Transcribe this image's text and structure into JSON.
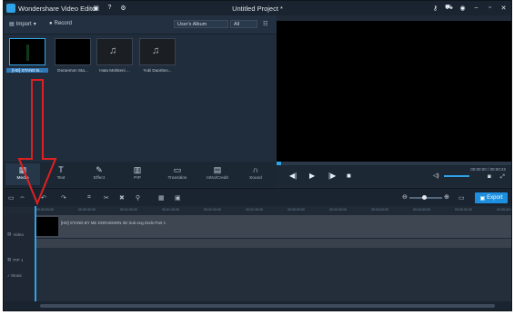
{
  "app": {
    "title": "Wondershare Video Editor",
    "project_title": "Untitled Project *"
  },
  "library_toolbar": {
    "import_label": "Import",
    "record_label": "Record",
    "album_value": "User's Album",
    "filter_value": "All"
  },
  "media": [
    {
      "label": "[HD] STAND B..."
    },
    {
      "label": "Doraemon Sta..."
    },
    {
      "label": "Hata Mohiteni ..."
    },
    {
      "label": "Yuki Daoriteo..."
    }
  ],
  "tabs": [
    "Media",
    "Text",
    "Effect",
    "PIP",
    "Transition",
    "Intro/Credit",
    "Sound"
  ],
  "preview": {
    "timecode": "00:00:00 / 00:00:22",
    "progress": 0.02
  },
  "timeline": {
    "export_label": "Export",
    "ruler": [
      "00:00:00:00",
      "00:00:30:00",
      "00:01:00:00",
      "00:01:30:00",
      "00:02:00:00",
      "00:02:30:00",
      "00:03:00:00",
      "00:03:30:00",
      "00:04:00:00",
      "00:04:30:00",
      "00:05:00:00",
      "00:05:30:00"
    ],
    "tracks": [
      "Video",
      "PIP 1",
      "Music"
    ],
    "clip_title": "[HD] STAND BY ME DORAEMON 3D Sub eng Ends Part 1"
  },
  "colors": {
    "accent": "#1e8fe0",
    "arrow": "#e02020"
  }
}
